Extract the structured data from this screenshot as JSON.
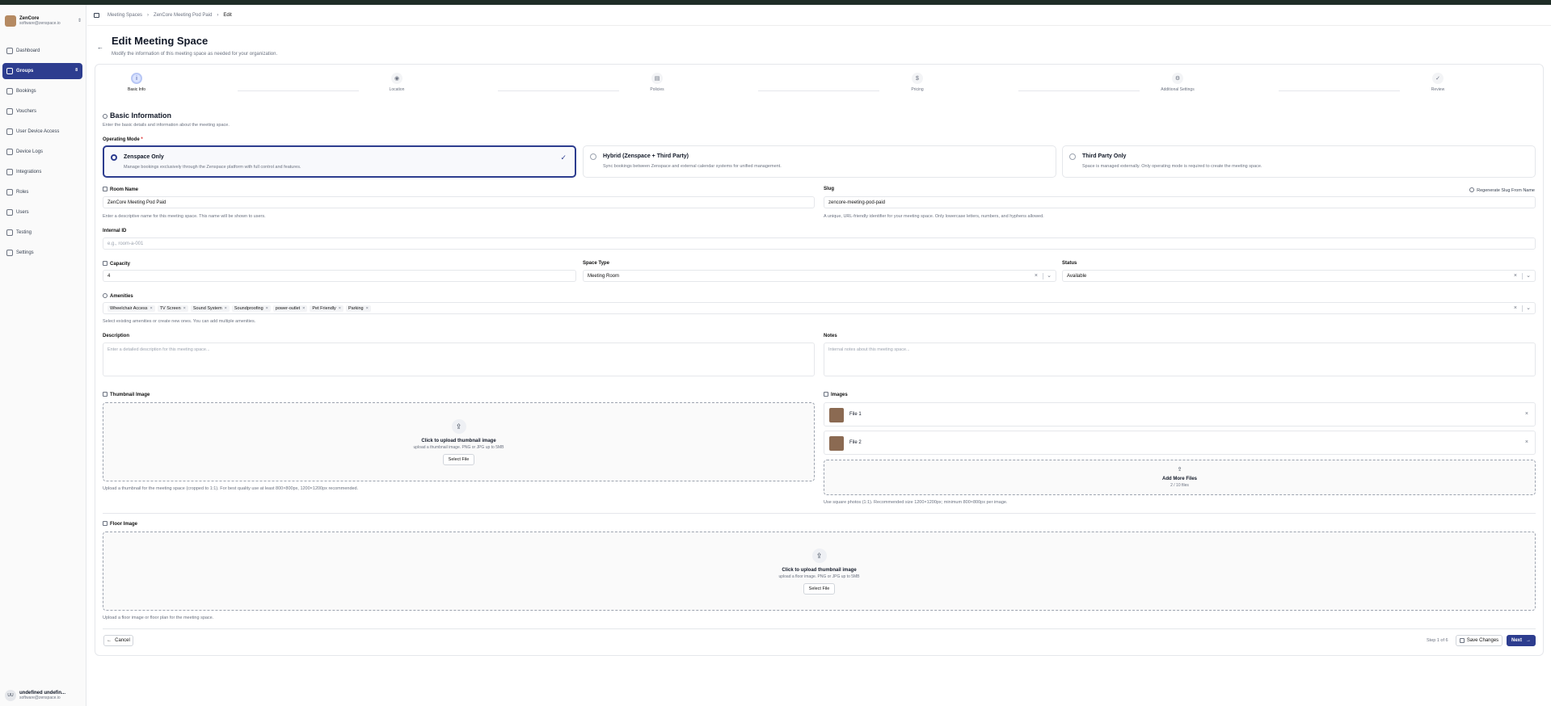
{
  "sidebar": {
    "brand_name": "ZenCore",
    "brand_email": "software@zenspace.io",
    "items": [
      {
        "label": "Dashboard",
        "icon": "dashboard-icon"
      },
      {
        "label": "Groups",
        "icon": "groups-icon",
        "badge": "8"
      },
      {
        "label": "Bookings",
        "icon": "calendar-icon"
      },
      {
        "label": "Vouchers",
        "icon": "ticket-icon"
      },
      {
        "label": "User Device Access",
        "icon": "device-icon"
      },
      {
        "label": "Device Logs",
        "icon": "log-icon"
      },
      {
        "label": "Integrations",
        "icon": "plug-icon"
      },
      {
        "label": "Roles",
        "icon": "shield-icon"
      },
      {
        "label": "Users",
        "icon": "users-icon"
      },
      {
        "label": "Testing",
        "icon": "flask-icon"
      },
      {
        "label": "Settings",
        "icon": "gear-icon"
      }
    ],
    "user": {
      "initials": "UU",
      "name": "undefined undefin...",
      "email": "software@zenspace.io"
    }
  },
  "breadcrumb": {
    "items": [
      "Meeting Spaces",
      "ZenCore Meeting Pod Paid",
      "Edit"
    ]
  },
  "page": {
    "title": "Edit Meeting Space",
    "subtitle": "Modify the information of this meeting space as needed for your organization."
  },
  "steps": [
    {
      "label": "Basic Info",
      "icon": "i"
    },
    {
      "label": "Location",
      "icon": "◉"
    },
    {
      "label": "Policies",
      "icon": "▤"
    },
    {
      "label": "Pricing",
      "icon": "$"
    },
    {
      "label": "Additional Settings",
      "icon": "⚙"
    },
    {
      "label": "Review",
      "icon": "✓"
    }
  ],
  "basic": {
    "title": "Basic Information",
    "subtitle": "Enter the basic details and information about the meeting space.",
    "operating_label": "Operating Mode",
    "required_mark": "*",
    "modes": [
      {
        "title": "Zenspace Only",
        "desc": "Manage bookings exclusively through the Zenspace platform with full control and features."
      },
      {
        "title": "Hybrid (Zenspace + Third Party)",
        "desc": "Sync bookings between Zenspace and external calendar systems for unified management."
      },
      {
        "title": "Third Party Only",
        "desc": "Space is managed externally. Only operating mode is required to create the meeting space."
      }
    ],
    "room_name_label": "Room Name",
    "room_name_value": "ZenCore Meeting Pod Paid",
    "room_name_hint": "Enter a descriptive name for this meeting space. This name will be shown to users.",
    "slug_label": "Slug",
    "slug_regen": "Regenerate Slug From Name",
    "slug_value": "zencore-meeting-pod-paid",
    "slug_hint": "A unique, URL-friendly identifier for your meeting space. Only lowercase letters, numbers, and hyphens allowed.",
    "internal_id_label": "Internal ID",
    "internal_id_placeholder": "e.g., room-a-001",
    "capacity_label": "Capacity",
    "capacity_value": "4",
    "space_type_label": "Space Type",
    "space_type_value": "Meeting Room",
    "status_label": "Status",
    "status_value": "Available",
    "amenities_label": "Amenities",
    "amenities": [
      "Wheelchair Access",
      "TV Screen",
      "Sound System",
      "Soundproofing",
      "power-outlet",
      "Pet Friendly",
      "Parking"
    ],
    "amenities_hint": "Select existing amenities or create new ones. You can add multiple amenities.",
    "description_label": "Description",
    "description_placeholder": "Enter a detailed description for this meeting space...",
    "notes_label": "Notes",
    "notes_placeholder": "Internal notes about this meeting space..."
  },
  "thumbnail": {
    "label": "Thumbnail Image",
    "upload_title": "Click to upload thumbnail image",
    "upload_sub": "upload a thumbnail image. PNG or JPG up to 5MB",
    "button": "Select File",
    "hint": "Upload a thumbnail for the meeting space (cropped to 1:1). For best quality use at least 800×800px, 1200×1200px recommended."
  },
  "images": {
    "label": "Images",
    "files": [
      "File 1",
      "File 2"
    ],
    "add_title": "Add More Files",
    "add_count": "2 / 10 files",
    "hint": "Use square photos (1:1). Recommended size 1200×1200px; minimum 800×800px per image."
  },
  "floor": {
    "label": "Floor Image",
    "upload_title": "Click to upload thumbnail image",
    "upload_sub": "upload a floor image. PNG or JPG up to 5MB",
    "button": "Select File",
    "hint": "Upload a floor image or floor plan for the meeting space."
  },
  "footer": {
    "cancel": "Cancel",
    "step_text": "Step 1 of 6",
    "save": "Save Changes",
    "next": "Next"
  }
}
